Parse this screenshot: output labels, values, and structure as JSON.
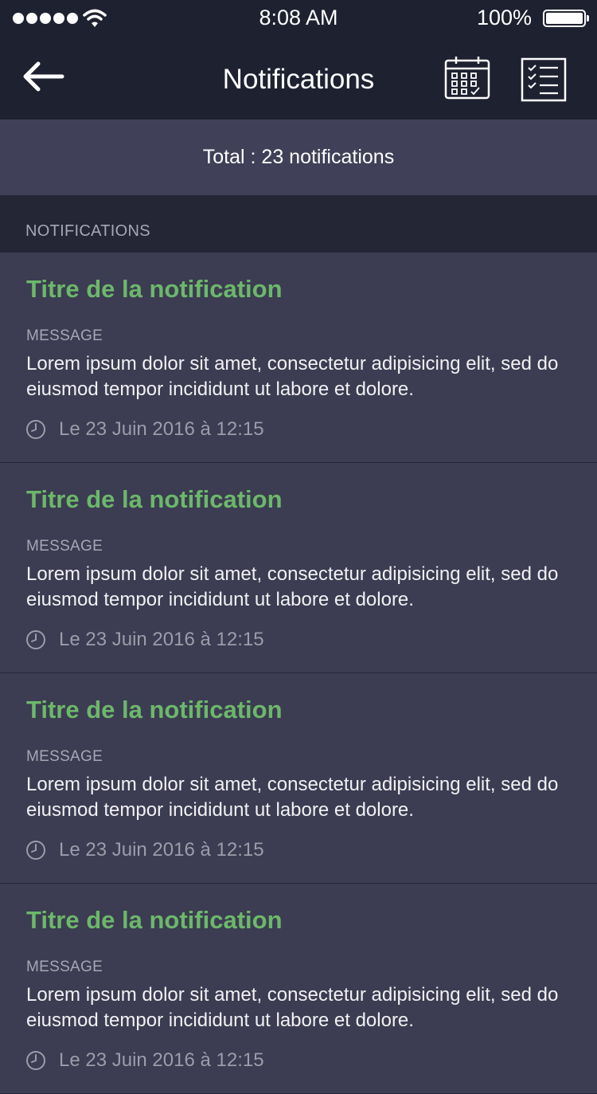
{
  "status_bar": {
    "time": "8:08 AM",
    "battery": "100%"
  },
  "header": {
    "title": "Notifications",
    "back_icon": "arrow-left-icon",
    "calendar_icon": "calendar-icon",
    "checklist_icon": "checklist-icon"
  },
  "summary": {
    "total_text": "Total : 23 notifications"
  },
  "section": {
    "label": "NOTIFICATIONS"
  },
  "colors": {
    "header_bg": "#1e2130",
    "banner_bg": "#404058",
    "section_bg": "#242636",
    "card_bg": "#3c3c52",
    "accent_green": "#6cb86a"
  },
  "notifications": [
    {
      "title": "Titre de la notification",
      "message_label": "MESSAGE",
      "message": "Lorem ipsum dolor sit amet, consectetur adipisicing elit, sed do eiusmod tempor incididunt ut labore et dolore.",
      "time": "Le 23 Juin 2016 à 12:15"
    },
    {
      "title": "Titre de la notification",
      "message_label": "MESSAGE",
      "message": "Lorem ipsum dolor sit amet, consectetur adipisicing elit, sed do eiusmod tempor incididunt ut labore et dolore.",
      "time": "Le 23 Juin 2016 à 12:15"
    },
    {
      "title": "Titre de la notification",
      "message_label": "MESSAGE",
      "message": "Lorem ipsum dolor sit amet, consectetur adipisicing elit, sed do eiusmod tempor incididunt ut labore et dolore.",
      "time": "Le 23 Juin 2016 à 12:15"
    },
    {
      "title": "Titre de la notification",
      "message_label": "MESSAGE",
      "message": "Lorem ipsum dolor sit amet, consectetur adipisicing elit, sed do eiusmod tempor incididunt ut labore et dolore.",
      "time": "Le 23 Juin 2016 à 12:15"
    }
  ]
}
